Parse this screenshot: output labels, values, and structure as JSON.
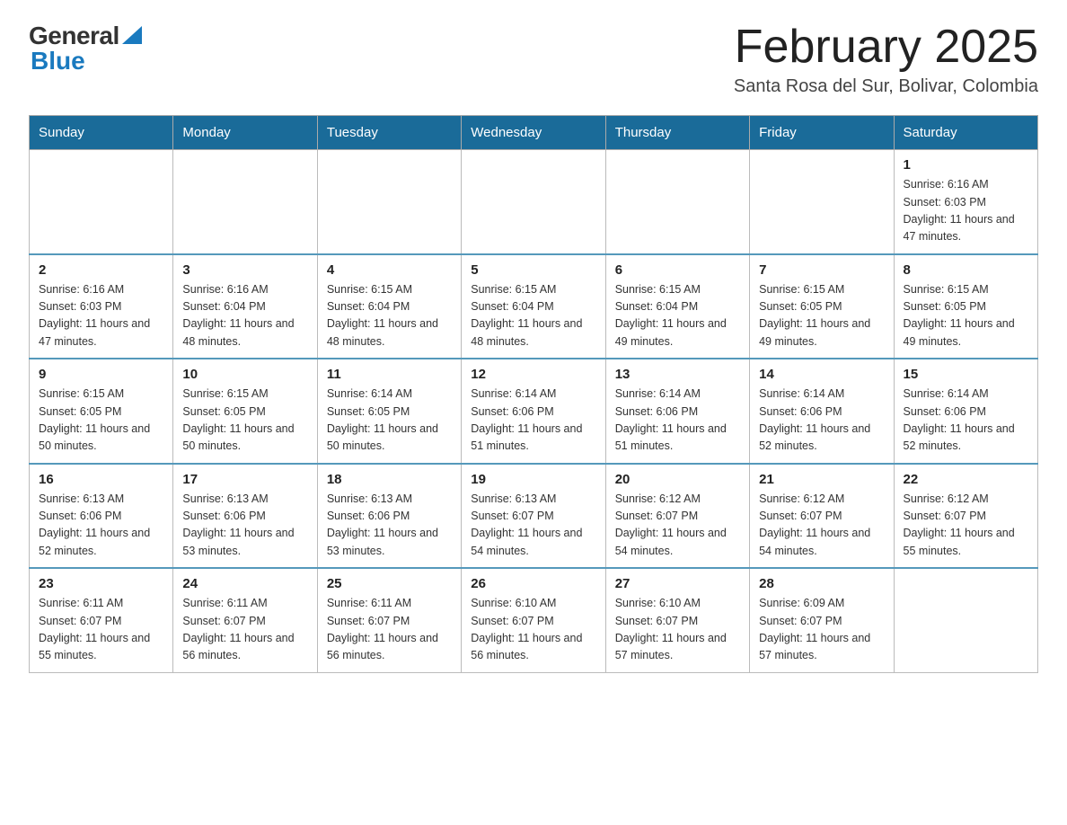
{
  "logo": {
    "general": "General",
    "blue": "Blue"
  },
  "header": {
    "month": "February 2025",
    "location": "Santa Rosa del Sur, Bolivar, Colombia"
  },
  "days_of_week": [
    "Sunday",
    "Monday",
    "Tuesday",
    "Wednesday",
    "Thursday",
    "Friday",
    "Saturday"
  ],
  "weeks": [
    [
      {
        "day": "",
        "sunrise": "",
        "sunset": "",
        "daylight": ""
      },
      {
        "day": "",
        "sunrise": "",
        "sunset": "",
        "daylight": ""
      },
      {
        "day": "",
        "sunrise": "",
        "sunset": "",
        "daylight": ""
      },
      {
        "day": "",
        "sunrise": "",
        "sunset": "",
        "daylight": ""
      },
      {
        "day": "",
        "sunrise": "",
        "sunset": "",
        "daylight": ""
      },
      {
        "day": "",
        "sunrise": "",
        "sunset": "",
        "daylight": ""
      },
      {
        "day": "1",
        "sunrise": "Sunrise: 6:16 AM",
        "sunset": "Sunset: 6:03 PM",
        "daylight": "Daylight: 11 hours and 47 minutes."
      }
    ],
    [
      {
        "day": "2",
        "sunrise": "Sunrise: 6:16 AM",
        "sunset": "Sunset: 6:03 PM",
        "daylight": "Daylight: 11 hours and 47 minutes."
      },
      {
        "day": "3",
        "sunrise": "Sunrise: 6:16 AM",
        "sunset": "Sunset: 6:04 PM",
        "daylight": "Daylight: 11 hours and 48 minutes."
      },
      {
        "day": "4",
        "sunrise": "Sunrise: 6:15 AM",
        "sunset": "Sunset: 6:04 PM",
        "daylight": "Daylight: 11 hours and 48 minutes."
      },
      {
        "day": "5",
        "sunrise": "Sunrise: 6:15 AM",
        "sunset": "Sunset: 6:04 PM",
        "daylight": "Daylight: 11 hours and 48 minutes."
      },
      {
        "day": "6",
        "sunrise": "Sunrise: 6:15 AM",
        "sunset": "Sunset: 6:04 PM",
        "daylight": "Daylight: 11 hours and 49 minutes."
      },
      {
        "day": "7",
        "sunrise": "Sunrise: 6:15 AM",
        "sunset": "Sunset: 6:05 PM",
        "daylight": "Daylight: 11 hours and 49 minutes."
      },
      {
        "day": "8",
        "sunrise": "Sunrise: 6:15 AM",
        "sunset": "Sunset: 6:05 PM",
        "daylight": "Daylight: 11 hours and 49 minutes."
      }
    ],
    [
      {
        "day": "9",
        "sunrise": "Sunrise: 6:15 AM",
        "sunset": "Sunset: 6:05 PM",
        "daylight": "Daylight: 11 hours and 50 minutes."
      },
      {
        "day": "10",
        "sunrise": "Sunrise: 6:15 AM",
        "sunset": "Sunset: 6:05 PM",
        "daylight": "Daylight: 11 hours and 50 minutes."
      },
      {
        "day": "11",
        "sunrise": "Sunrise: 6:14 AM",
        "sunset": "Sunset: 6:05 PM",
        "daylight": "Daylight: 11 hours and 50 minutes."
      },
      {
        "day": "12",
        "sunrise": "Sunrise: 6:14 AM",
        "sunset": "Sunset: 6:06 PM",
        "daylight": "Daylight: 11 hours and 51 minutes."
      },
      {
        "day": "13",
        "sunrise": "Sunrise: 6:14 AM",
        "sunset": "Sunset: 6:06 PM",
        "daylight": "Daylight: 11 hours and 51 minutes."
      },
      {
        "day": "14",
        "sunrise": "Sunrise: 6:14 AM",
        "sunset": "Sunset: 6:06 PM",
        "daylight": "Daylight: 11 hours and 52 minutes."
      },
      {
        "day": "15",
        "sunrise": "Sunrise: 6:14 AM",
        "sunset": "Sunset: 6:06 PM",
        "daylight": "Daylight: 11 hours and 52 minutes."
      }
    ],
    [
      {
        "day": "16",
        "sunrise": "Sunrise: 6:13 AM",
        "sunset": "Sunset: 6:06 PM",
        "daylight": "Daylight: 11 hours and 52 minutes."
      },
      {
        "day": "17",
        "sunrise": "Sunrise: 6:13 AM",
        "sunset": "Sunset: 6:06 PM",
        "daylight": "Daylight: 11 hours and 53 minutes."
      },
      {
        "day": "18",
        "sunrise": "Sunrise: 6:13 AM",
        "sunset": "Sunset: 6:06 PM",
        "daylight": "Daylight: 11 hours and 53 minutes."
      },
      {
        "day": "19",
        "sunrise": "Sunrise: 6:13 AM",
        "sunset": "Sunset: 6:07 PM",
        "daylight": "Daylight: 11 hours and 54 minutes."
      },
      {
        "day": "20",
        "sunrise": "Sunrise: 6:12 AM",
        "sunset": "Sunset: 6:07 PM",
        "daylight": "Daylight: 11 hours and 54 minutes."
      },
      {
        "day": "21",
        "sunrise": "Sunrise: 6:12 AM",
        "sunset": "Sunset: 6:07 PM",
        "daylight": "Daylight: 11 hours and 54 minutes."
      },
      {
        "day": "22",
        "sunrise": "Sunrise: 6:12 AM",
        "sunset": "Sunset: 6:07 PM",
        "daylight": "Daylight: 11 hours and 55 minutes."
      }
    ],
    [
      {
        "day": "23",
        "sunrise": "Sunrise: 6:11 AM",
        "sunset": "Sunset: 6:07 PM",
        "daylight": "Daylight: 11 hours and 55 minutes."
      },
      {
        "day": "24",
        "sunrise": "Sunrise: 6:11 AM",
        "sunset": "Sunset: 6:07 PM",
        "daylight": "Daylight: 11 hours and 56 minutes."
      },
      {
        "day": "25",
        "sunrise": "Sunrise: 6:11 AM",
        "sunset": "Sunset: 6:07 PM",
        "daylight": "Daylight: 11 hours and 56 minutes."
      },
      {
        "day": "26",
        "sunrise": "Sunrise: 6:10 AM",
        "sunset": "Sunset: 6:07 PM",
        "daylight": "Daylight: 11 hours and 56 minutes."
      },
      {
        "day": "27",
        "sunrise": "Sunrise: 6:10 AM",
        "sunset": "Sunset: 6:07 PM",
        "daylight": "Daylight: 11 hours and 57 minutes."
      },
      {
        "day": "28",
        "sunrise": "Sunrise: 6:09 AM",
        "sunset": "Sunset: 6:07 PM",
        "daylight": "Daylight: 11 hours and 57 minutes."
      },
      {
        "day": "",
        "sunrise": "",
        "sunset": "",
        "daylight": ""
      }
    ]
  ]
}
